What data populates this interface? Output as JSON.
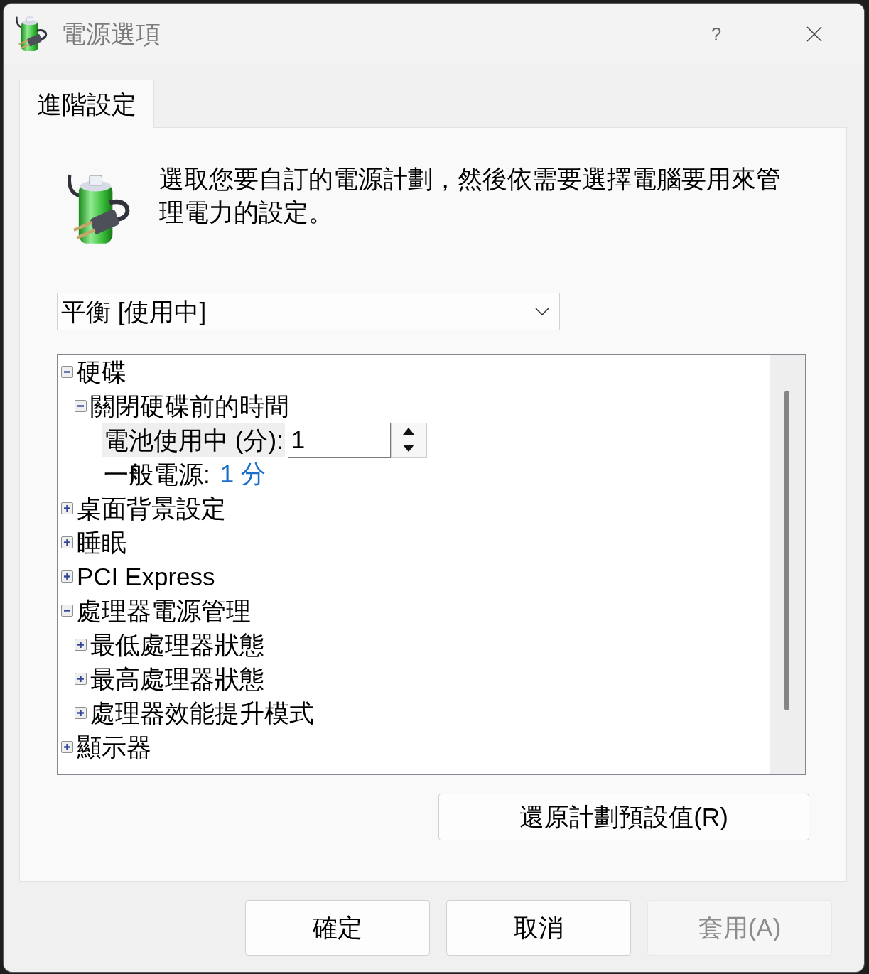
{
  "window": {
    "title": "電源選項",
    "help_label": "?"
  },
  "tabs": [
    {
      "label": "進階設定",
      "selected": true
    }
  ],
  "description": "選取您要自訂的電源計劃，然後依需要選擇電腦要用來管理電力的設定。",
  "plan_dropdown": {
    "value": "平衡 [使用中]"
  },
  "settings_tree": {
    "items": [
      {
        "kind": "group",
        "label": "硬碟",
        "expanded": true,
        "selected": false,
        "children": [
          {
            "kind": "group",
            "label": "關閉硬碟前的時間",
            "expanded": true,
            "selected": false,
            "children": [
              {
                "kind": "spin",
                "label": "電池使用中 (分):",
                "value": "1",
                "selected": true
              },
              {
                "kind": "value",
                "label": "一般電源:",
                "value": "1 分",
                "selected": false
              }
            ]
          }
        ]
      },
      {
        "kind": "group",
        "label": "桌面背景設定",
        "expanded": false,
        "selected": false
      },
      {
        "kind": "group",
        "label": "睡眠",
        "expanded": false,
        "selected": false
      },
      {
        "kind": "group",
        "label": "PCI Express",
        "expanded": false,
        "selected": false
      },
      {
        "kind": "group",
        "label": "處理器電源管理",
        "expanded": true,
        "selected": false,
        "children": [
          {
            "kind": "group",
            "label": "最低處理器狀態",
            "expanded": false,
            "selected": false
          },
          {
            "kind": "group",
            "label": "最高處理器狀態",
            "expanded": false,
            "selected": false
          },
          {
            "kind": "group",
            "label": "處理器效能提升模式",
            "expanded": false,
            "selected": false
          }
        ]
      },
      {
        "kind": "group",
        "label": "顯示器",
        "expanded": false,
        "selected": false
      }
    ]
  },
  "restore_button": {
    "label": "還原計劃預設值(R)"
  },
  "buttons": [
    {
      "label": "確定",
      "disabled": false
    },
    {
      "label": "取消",
      "disabled": false
    },
    {
      "label": "套用(A)",
      "disabled": true
    }
  ]
}
